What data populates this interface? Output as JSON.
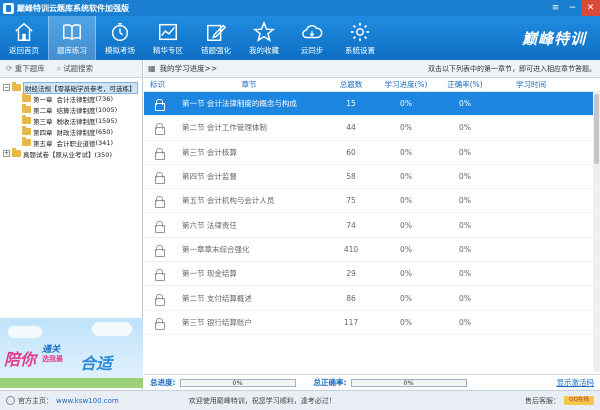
{
  "window": {
    "title": "巅峰特训云题库系统软件加强版"
  },
  "toolbar": {
    "items": [
      {
        "label": "返回首页",
        "icon": "home-icon"
      },
      {
        "label": "题库练习",
        "icon": "book-icon"
      },
      {
        "label": "模拟考场",
        "icon": "timer-icon"
      },
      {
        "label": "精华专区",
        "icon": "chart-icon"
      },
      {
        "label": "错题强化",
        "icon": "edit-icon"
      },
      {
        "label": "我的收藏",
        "icon": "star-icon"
      },
      {
        "label": "云同步",
        "icon": "cloud-icon"
      },
      {
        "label": "系统设置",
        "icon": "gear-icon"
      }
    ],
    "active_index": 1,
    "brand": "巅峰特训"
  },
  "left": {
    "tabs": [
      "重下题库",
      "试题搜索"
    ],
    "tree": {
      "root1": "财经法规【零基础学员参考，可选练】",
      "chapters": [
        {
          "ch": "第一章",
          "name": "会计法律制度",
          "count": "(736)"
        },
        {
          "ch": "第二章",
          "name": "结算法律制度",
          "count": "(1005)"
        },
        {
          "ch": "第三章",
          "name": "税收法律制度",
          "count": "(1595)"
        },
        {
          "ch": "第四章",
          "name": "财政法律制度",
          "count": "(650)"
        },
        {
          "ch": "第五章",
          "name": "会计职业道德",
          "count": "(341)"
        }
      ],
      "root2": "真题试卷【原从业考试】(350)"
    },
    "promo": {
      "t1": "陪你",
      "t2": "通关",
      "t3": "合适",
      "t4": "选我最"
    }
  },
  "main": {
    "progress_label": "我的学习进度>>",
    "hint": "双击以下列表中的第一章节，即可进入相应章节答题。",
    "columns": [
      "标识",
      "章节",
      "总题数",
      "学习进度(%)",
      "正确率(%)",
      "学习时间"
    ],
    "rows": [
      {
        "section": "第一节  会计法律制度的概念与构成",
        "total": "15",
        "progress": "0%",
        "accuracy": "0%",
        "time": ""
      },
      {
        "section": "第二节  会计工作管理体制",
        "total": "44",
        "progress": "0%",
        "accuracy": "0%",
        "time": ""
      },
      {
        "section": "第三节  会计核算",
        "total": "60",
        "progress": "0%",
        "accuracy": "0%",
        "time": ""
      },
      {
        "section": "第四节  会计监督",
        "total": "58",
        "progress": "0%",
        "accuracy": "0%",
        "time": ""
      },
      {
        "section": "第五节  会计机构与会计人员",
        "total": "75",
        "progress": "0%",
        "accuracy": "0%",
        "time": ""
      },
      {
        "section": "第六节  法律责任",
        "total": "74",
        "progress": "0%",
        "accuracy": "0%",
        "time": ""
      },
      {
        "section": "第一章章末综合强化",
        "total": "410",
        "progress": "0%",
        "accuracy": "0%",
        "time": ""
      },
      {
        "section": "第一节  现金结算",
        "total": "29",
        "progress": "0%",
        "accuracy": "0%",
        "time": ""
      },
      {
        "section": "第二节  支付结算概述",
        "total": "86",
        "progress": "0%",
        "accuracy": "0%",
        "time": ""
      },
      {
        "section": "第三节  银行结算账户",
        "total": "117",
        "progress": "0%",
        "accuracy": "0%",
        "time": ""
      }
    ],
    "selected_row": 0
  },
  "totals": {
    "progress_label": "总进度:",
    "progress_value": "0%",
    "progress_fraction": 0,
    "accuracy_label": "总正确率:",
    "accuracy_value": "0%",
    "accuracy_fraction": 0,
    "activate_link": "显示激活码"
  },
  "status": {
    "site_label": "官方主页：",
    "site": "www.ksw100.com",
    "welcome": "欢迎使用巅峰特训，祝您学习顺利，逢考必过！",
    "service": "售后客服：",
    "qq": "QQ在线"
  },
  "colors": {
    "accent": "#1d86e0",
    "toolbar": "#1f8ce0",
    "title": "#1a7fd0"
  }
}
